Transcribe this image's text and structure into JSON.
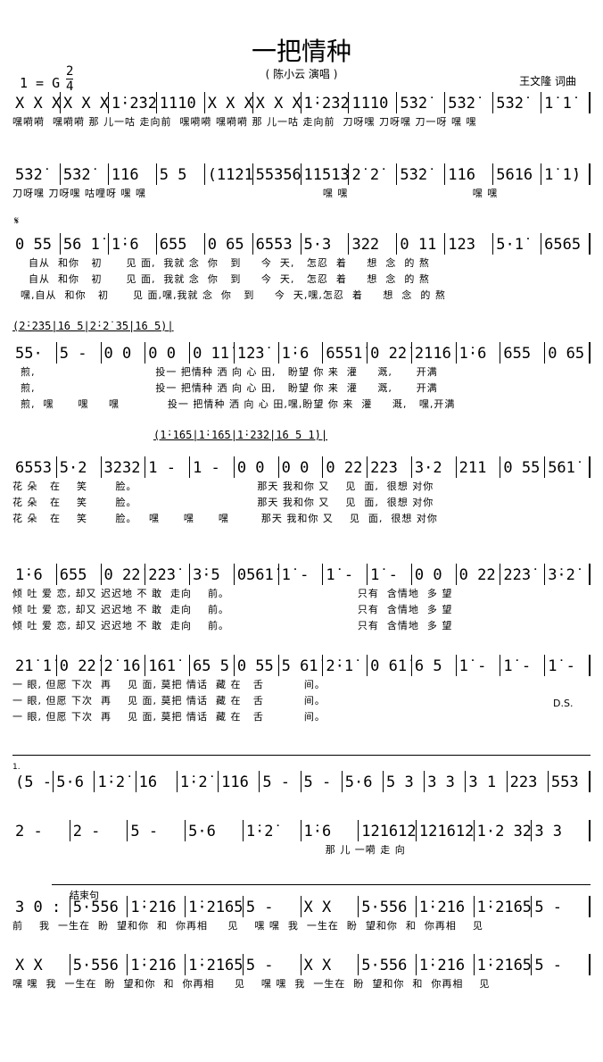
{
  "header": {
    "title": "一把情种",
    "singer": "( 陈小云 演唱 )",
    "key": "1 = G",
    "time_top": "2",
    "time_bottom": "4",
    "author": "王文隆 词曲"
  },
  "marks": {
    "segno": "𝄋",
    "ds": "D.S.",
    "volta1": "1.",
    "ending": "结束句"
  },
  "interludes": [
    "(2̇·2̇3̇5̇|1̇6 5|2̇·2̇ 3̇5̇|1̇6 5)|",
    "(1̇·1̇65|1̇·1̇65|1̇·2̇3̇2̇|1̇6 5 1̇)|"
  ],
  "systems": [
    {
      "measures": [
        "X X X",
        "X X X",
        "1̇·2̇3̇2̇",
        "1̇1̇1̇0",
        "X X X",
        "X X X",
        "1̇·2̇3̇2̇",
        "1̇1̇1̇0",
        "5̇3̇2̇",
        "5̇3̇2̇",
        "5̇3̇2̇",
        "1̇ 1̇"
      ],
      "lyrics": [
        "嘿嗬嗬  嘿嗬嗬 那 儿一咕 走向前  嘿嗬嗬 嘿嗬嗬 那 儿一咕 走向前  刀呀嘿 刀呀嘿 刀一呀 嘿 嘿"
      ]
    },
    {
      "measures": [
        "5̇3̇2̇",
        "5̇3̇2̇",
        "1̇1̇6",
        "5 5",
        "(1̇1̇2̇1̇6",
        "55356",
        "1̇1̇5̇1̇3̇",
        "2̇ 2̇",
        "5̇3̇2̇",
        "1̇1̇6",
        "561̇6",
        "1̇ 1̇)"
      ],
      "lyrics": [
        "刀呀嘿 刀呀嘿 咕哩呀 嘿 嘿                                            嘿 嘿                               嘿 嘿"
      ]
    },
    {
      "measures": [
        "0 55",
        "56 1̇",
        "1̇·6",
        "655",
        "0 65",
        "6553",
        "5·3",
        "322",
        "0 11",
        "123",
        "5·1̇",
        "6565"
      ],
      "lyrics": [
        "    自从  和你   初      见 面,  我就 念  你   到     今  天,   怎忍  着     想  念  的 熬",
        "    自从  和你   初      见 面,  我就 念  你   到     今  天,   怎忍  着     想  念  的 熬",
        "  嘿,自从  和你   初      见 面,嘿,我就 念  你   到     今  天,嘿,怎忍  着     想  念  的 熬"
      ]
    },
    {
      "measures": [
        "55·",
        "5 -",
        "0 0",
        "0 0",
        "0 1̇1̇",
        "1̇2̇3̇",
        "1̇·6",
        "6551̇",
        "0 2̇2̇",
        "2̇1̇1̇6",
        "1̇·6",
        "655",
        "0 65"
      ],
      "lyrics": [
        "  煎,                              投一 把情种 洒 向 心 田,   盼望 你 来  灌     溉,      开满",
        "  煎,                              投一 把情种 洒 向 心 田,   盼望 你 来  灌     溉,      开满",
        "  煎,  嘿      嘿     嘿            投一 把情种 洒 向 心 田,嘿,盼望 你 来  灌     溉,   嘿,开满"
      ]
    },
    {
      "measures": [
        "6553",
        "5·2",
        "3232",
        "1 -",
        "1 -",
        "0 0",
        "0 0",
        "0 22",
        "223",
        "3·2",
        "211",
        "0 55",
        "561̇"
      ],
      "lyrics": [
        "花 朵   在    笑       脸。                              那天 我和你 又    见  面,  很想 对你",
        "花 朵   在    笑       脸。                              那天 我和你 又    见  面,  很想 对你",
        "花 朵   在    笑       脸。   嘿      嘿      嘿        那天 我和你 又    见  面,  很想 对你"
      ]
    },
    {
      "measures": [
        "1̇·6",
        "655",
        "0 2̇2̇",
        "2̇2̇3̇",
        "3̇·5",
        "0561̇",
        "1̇ -",
        "1̇ -",
        "1̇ -",
        "0 0",
        "0 2̇2̇",
        "2̇2̇3̇",
        "3̇·2̇"
      ],
      "lyrics": [
        "倾 吐 爱 恋, 却又 迟迟地 不 敢  走向    前。                                只有  含情地  多 望",
        "倾 吐 爱 恋, 却又 迟迟地 不 敢  走向    前。                                只有  含情地  多 望",
        "倾 吐 爱 恋, 却又 迟迟地 不 敢  走向    前。                                只有  含情地  多 望"
      ]
    },
    {
      "measures": [
        "2̇1̇ 1̇",
        "0 2̇2̇",
        "2̇ 1̇6",
        "1̇61̇",
        "65 5",
        "0 55",
        "5 61̇",
        "2̇·1̇",
        "0 61̇",
        "6 5",
        "1̇ -",
        "1̇ -",
        "1̇ -"
      ],
      "lyrics": [
        "一 眼, 但愿 下次  再    见 面, 莫把 情话  藏 在   舌          间。",
        "一 眼, 但愿 下次  再    见 面, 莫把 情话  藏 在   舌          间。",
        "一 眼, 但愿 下次  再    见 面, 莫把 情话  藏 在   舌          间。"
      ]
    },
    {
      "measures": [
        "(5 -",
        "5·6",
        "1̇·2̇",
        "1̇6",
        "1̇·2̇",
        "1̇1̇6",
        "5 -",
        "5 -",
        "5·6",
        "5 3",
        "3 3",
        "3 1",
        "223",
        "553"
      ],
      "lyrics": []
    },
    {
      "measures": [
        "2 -",
        "2 -",
        "5 -",
        "5·6",
        "1̇·2̇",
        "1̇·6",
        "1̇2̇1̇61̇2̇1̇6",
        "1̇2̇1̇61̇2̇1̇6)",
        "1·2 32",
        "3 3"
      ],
      "lyrics": [
        "                                                                              那 儿 一嗬 走 向"
      ]
    },
    {
      "measures": [
        "3 0 :",
        "5·556",
        "1̇·2̇1̇6",
        "1̇·2̇1̇65",
        "5 -",
        "X X",
        "5·556",
        "1̇·2̇1̇6",
        "1̇·2̇1̇65",
        "5 -"
      ],
      "lyrics": [
        "前    我  一生在  盼  望和你  和  你再相     见    嘿 嘿  我  一生在  盼  望和你  和  你再相    见"
      ]
    },
    {
      "measures": [
        "X X",
        "5·556",
        "1̇·2̇1̇6",
        "1̇·2̇1̇65",
        "5 -",
        "X X",
        "5·556",
        "1̇·2̇1̇6",
        "1̇·2̇1̇65",
        "5 -"
      ],
      "lyrics": [
        "嘿 嘿  我  一生在  盼  望和你  和  你再相     见    嘿 嘿  我  一生在  盼  望和你  和  你再相    见"
      ]
    }
  ]
}
